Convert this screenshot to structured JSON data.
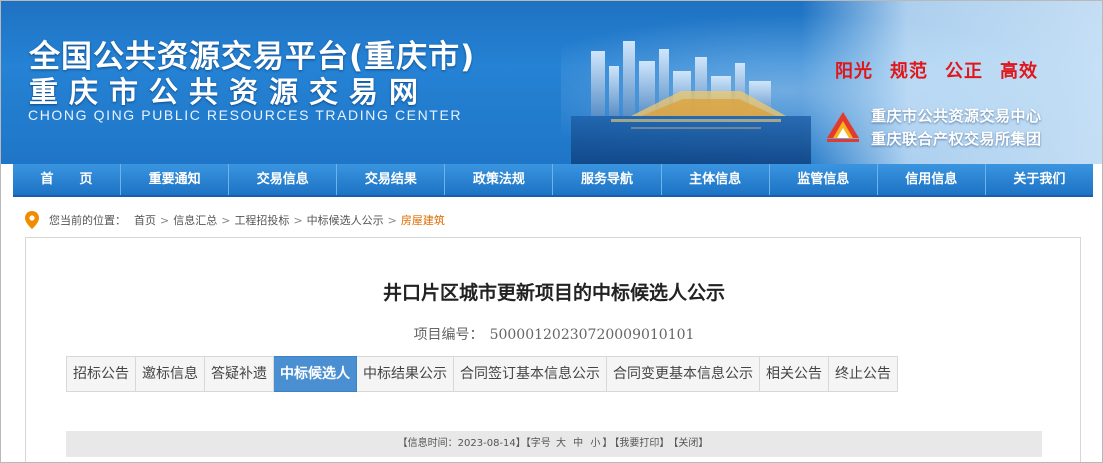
{
  "banner": {
    "title_line1": "全国公共资源交易平台(重庆市)",
    "title_line2": "重庆市公共资源交易网",
    "title_en": "CHONG QING PUBLIC RESOURCES TRADING CENTER",
    "slogans": [
      "阳光",
      "规范",
      "公正",
      "高效"
    ],
    "org_line1": "重庆市公共资源交易中心",
    "org_line2": "重庆联合产权交易所集团",
    "slogan_color": "#e0161b"
  },
  "nav": {
    "items": [
      "首　　页",
      "重要通知",
      "交易信息",
      "交易结果",
      "政策法规",
      "服务导航",
      "主体信息",
      "监管信息",
      "信用信息",
      "关于我们"
    ]
  },
  "breadcrumb": {
    "prefix": "您当前的位置：",
    "items": [
      "首页",
      "信息汇总",
      "工程招投标",
      "中标候选人公示",
      "房屋建筑"
    ],
    "separator": ">"
  },
  "article": {
    "title": "井口片区城市更新项目的中标候选人公示",
    "project_label": "项目编号：",
    "project_no": "500001202307200090101​01"
  },
  "tabs": {
    "items": [
      "招标公告",
      "邀标信息",
      "答疑补遗",
      "中标候选人",
      "中标结果公示",
      "合同签订基本信息公示",
      "合同变更基本信息公示",
      "相关公告",
      "终止公告"
    ],
    "active_index": 3,
    "active_color": "#4a8fd1"
  },
  "infobar": {
    "open": "【信息时间：",
    "date": "2023-08-14",
    "close": "】",
    "font_label": "【字号",
    "size_large": "大",
    "size_medium": "中",
    "size_small": "小",
    "font_close": "】",
    "print": "【我要打印】",
    "close_window": "【关闭】"
  }
}
